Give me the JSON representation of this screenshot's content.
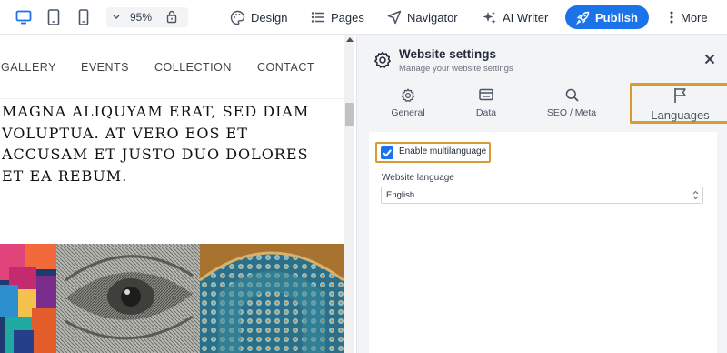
{
  "toolbar": {
    "zoom": "95%",
    "design_label": "Design",
    "pages_label": "Pages",
    "navigator_label": "Navigator",
    "ai_writer_label": "AI Writer",
    "publish_label": "Publish",
    "more_label": "More",
    "device_icons": [
      "desktop-icon",
      "tablet-icon",
      "mobile-icon"
    ]
  },
  "canvas": {
    "nav": [
      "GALLERY",
      "EVENTS",
      "COLLECTION",
      "CONTACT"
    ],
    "heading_lines": [
      "MAGNA ALIQUYAM ERAT, SED DIAM",
      "VOLUPTUA. AT VERO EOS ET",
      "ACCUSAM ET JUSTO DUO DOLORES",
      "ET EA REBUM."
    ]
  },
  "panel": {
    "title": "Website settings",
    "subtitle": "Manage your website settings",
    "tabs": [
      {
        "label": "General",
        "icon": "gear-icon"
      },
      {
        "label": "Data",
        "icon": "card-icon"
      },
      {
        "label": "SEO / Meta",
        "icon": "search-icon"
      },
      {
        "label": "Languages",
        "icon": "flag-icon"
      }
    ],
    "multilanguage_label": "Enable multilanguage",
    "multilanguage_checked": true,
    "website_language_label": "Website language",
    "website_language_value": "English"
  },
  "colors": {
    "accent": "#1a73e8",
    "highlight": "#d89a35",
    "panel_bg": "#f3f4f6"
  }
}
